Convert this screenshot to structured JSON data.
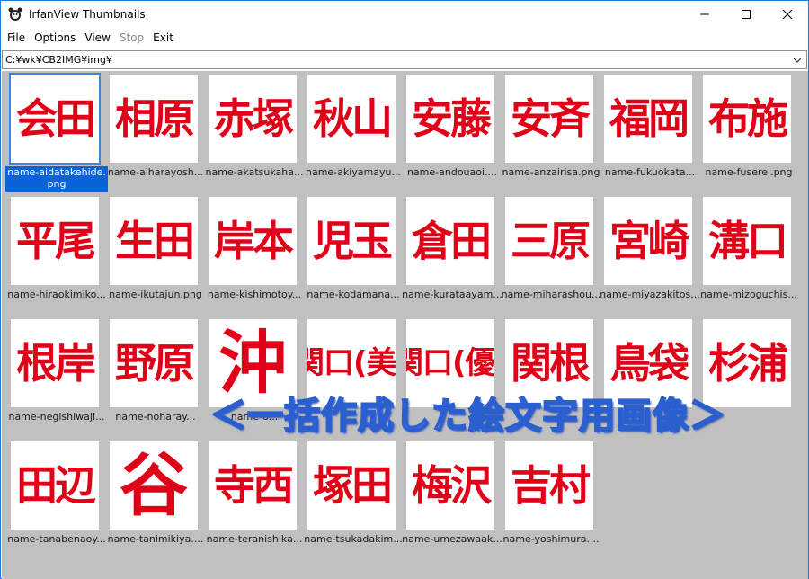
{
  "window": {
    "title": "IrfanView Thumbnails"
  },
  "menu": {
    "file": "File",
    "options": "Options",
    "view": "View",
    "stop": "Stop",
    "exit": "Exit"
  },
  "path": "C:¥wk¥CB2IMG¥img¥",
  "thumbnails": [
    {
      "text": "会田",
      "caption": "name-aidatakehide.png"
    },
    {
      "text": "相原",
      "caption": "name-aiharayosh..."
    },
    {
      "text": "赤塚",
      "caption": "name-akatsukaha..."
    },
    {
      "text": "秋山",
      "caption": "name-akiyamayu..."
    },
    {
      "text": "安藤",
      "caption": "name-andouaoi...."
    },
    {
      "text": "安斉",
      "caption": "name-anzairisa.png"
    },
    {
      "text": "福岡",
      "caption": "name-fukuokata..."
    },
    {
      "text": "布施",
      "caption": "name-fuserei.png"
    },
    {
      "text": "平尾",
      "caption": "name-hiraokimiko..."
    },
    {
      "text": "生田",
      "caption": "name-ikutajun.png"
    },
    {
      "text": "岸本",
      "caption": "name-kishimotoy..."
    },
    {
      "text": "児玉",
      "caption": "name-kodamana..."
    },
    {
      "text": "倉田",
      "caption": "name-kurataayam..."
    },
    {
      "text": "三原",
      "caption": "name-miharashou..."
    },
    {
      "text": "宮崎",
      "caption": "name-miyazakitos..."
    },
    {
      "text": "溝口",
      "caption": "name-mizoguchis..."
    },
    {
      "text": "根岸",
      "caption": "name-negishiwaji..."
    },
    {
      "text": "野原",
      "caption": "name-noharay..."
    },
    {
      "text": "沖",
      "caption": "name-o..."
    },
    {
      "text": "関口(美)",
      "caption": ""
    },
    {
      "text": "関口(優)",
      "caption": ""
    },
    {
      "text": "関根",
      "caption": ""
    },
    {
      "text": "鳥袋",
      "caption": ""
    },
    {
      "text": "杉浦",
      "caption": ""
    },
    {
      "text": "田辺",
      "caption": "name-tanabenaoy..."
    },
    {
      "text": "谷",
      "caption": "name-tanimikiya...."
    },
    {
      "text": "寺西",
      "caption": "name-teranishika..."
    },
    {
      "text": "塚田",
      "caption": "name-tsukadakim..."
    },
    {
      "text": "梅沢",
      "caption": "name-umezawaak..."
    },
    {
      "text": "吉村",
      "caption": "name-yoshimura...."
    }
  ],
  "overlay_caption": "＜一括作成した絵文字用画像＞",
  "colors": {
    "thumb_text": "#e00018",
    "selection": "#0a64d8",
    "grid_bg": "#c0c0c0"
  }
}
